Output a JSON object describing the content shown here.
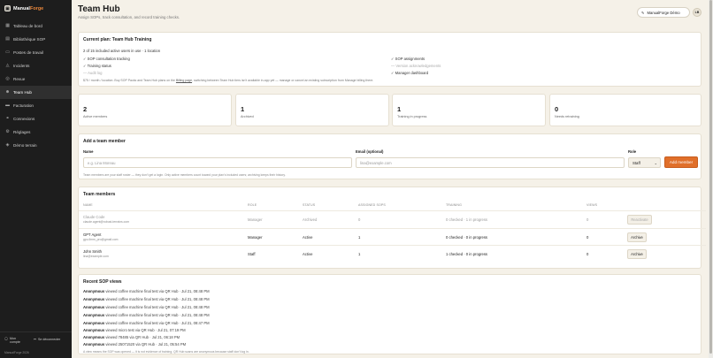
{
  "brand": {
    "name_a": "Manual",
    "name_b": "Forge"
  },
  "sidebar": {
    "items": [
      {
        "label": "Tableau de bord",
        "icon": "dashboard-icon"
      },
      {
        "label": "Bibliothèque SOP",
        "icon": "library-icon"
      },
      {
        "label": "Postes de travail",
        "icon": "workstation-icon"
      },
      {
        "label": "Incidents",
        "icon": "alert-icon"
      },
      {
        "label": "Revue",
        "icon": "review-icon"
      },
      {
        "label": "Team Hub",
        "icon": "team-icon",
        "active": true
      },
      {
        "label": "Facturation",
        "icon": "billing-icon"
      },
      {
        "label": "Connexions",
        "icon": "connections-icon"
      },
      {
        "label": "Réglages",
        "icon": "settings-icon"
      },
      {
        "label": "Démo terrain",
        "icon": "demo-icon"
      }
    ],
    "account_label": "Mon compte",
    "logout_label": "Se déconnecter",
    "copyright": "ManualForge 2026"
  },
  "header": {
    "title": "Team Hub",
    "subtitle": "Assign SOPs, track consultation, and record training checks.",
    "workspace": "ManualForge Démo",
    "avatar": "LB"
  },
  "plan": {
    "title": "Current plan: Team Hub Training",
    "usage": "2 of 15 included active users in use · 1 location",
    "features_left": [
      "✓ SOP consultation tracking",
      "✓ Training status",
      "— Audit log"
    ],
    "features_right": [
      "✓ SOP assignments",
      "— Version acknowledgements",
      "✓ Manager dashboard"
    ],
    "note_a": "$75 / month / location. Buy SOP Packs and Team Hub plans on the ",
    "note_link": "Billing page",
    "note_b": ", switching between Team Hub tiers isn't available in-app yet — manage or cancel an existing subscription from Manage billing there."
  },
  "stats": [
    {
      "value": "2",
      "label": "Active members"
    },
    {
      "value": "1",
      "label": "Archived"
    },
    {
      "value": "1",
      "label": "Training in progress"
    },
    {
      "value": "0",
      "label": "Needs retraining"
    }
  ],
  "add_member": {
    "title": "Add a team member",
    "name_label": "Name",
    "name_placeholder": "e.g. Lina Moreau",
    "email_label": "Email (optional)",
    "email_placeholder": "lina@example.com",
    "role_label": "Role",
    "role_value": "Staff",
    "button": "Add member",
    "hint": "Team members are your staff roster — they don't get a login. Only active members count toward your plan's included users; archiving keeps their history."
  },
  "members": {
    "title": "Team members",
    "columns": [
      "NAME",
      "ROLE",
      "STATUS",
      "ASSIGNED SOPS",
      "TRAINING",
      "VIEWS"
    ],
    "rows": [
      {
        "name": "Claude Code",
        "email": "claude.agent@robust-terrains.com",
        "role": "Manager",
        "status": "Archived",
        "sops": "0",
        "training": "0 checked · 1 in progress",
        "views": "0",
        "action": "Reactivate",
        "dim": true
      },
      {
        "name": "GPT Agent",
        "email": "gpu.llmm_pro@gmail.com",
        "role": "Manager",
        "status": "Active",
        "sops": "1",
        "training": "0 checked · 0 in progress",
        "views": "0",
        "action": "Archive",
        "dim": false
      },
      {
        "name": "John Smith",
        "email": "lina@example.com",
        "role": "Staff",
        "status": "Active",
        "sops": "1",
        "training": "1 checked · 0 in progress",
        "views": "0",
        "action": "Archive",
        "dim": false
      }
    ]
  },
  "views": {
    "title": "Recent SOP views",
    "items": [
      {
        "who": "Anonymous",
        "text": " viewed coffee machine final test via QR Hub · Jul 21, 08:48 PM"
      },
      {
        "who": "Anonymous",
        "text": " viewed coffee machine final test via QR Hub · Jul 21, 08:48 PM"
      },
      {
        "who": "Anonymous",
        "text": " viewed coffee machine final test via QR Hub · Jul 21, 08:48 PM"
      },
      {
        "who": "Anonymous",
        "text": " viewed coffee machine final test via QR Hub · Jul 21, 08:48 PM"
      },
      {
        "who": "Anonymous",
        "text": " viewed coffee machine final test via QR Hub · Jul 21, 08:47 PM"
      },
      {
        "who": "Anonymous",
        "text": " viewed micro test via QR Hub · Jul 21, 07:19 PM"
      },
      {
        "who": "Anonymous",
        "text": " viewed 78485 via QR Hub · Jul 21, 06:18 PM"
      },
      {
        "who": "Anonymous",
        "text": " viewed 25071520 via QR Hub · Jul 21, 05:54 PM"
      }
    ],
    "note": "A view means the SOP was opened — it is not evidence of training. QR Hub scans are anonymous because staff don't log in."
  }
}
